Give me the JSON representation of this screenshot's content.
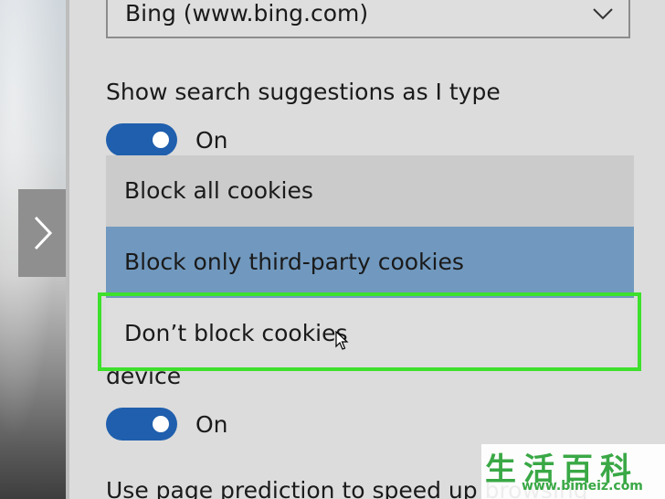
{
  "search_engine": {
    "selected": "Bing (www.bing.com)"
  },
  "search_suggestions": {
    "label": "Show search suggestions as I type",
    "toggle_state": "On"
  },
  "cookies_dropdown": {
    "options": [
      "Block all cookies",
      "Block only third-party cookies",
      "Don’t block cookies"
    ],
    "selected_index": 1,
    "hovered_index": 2
  },
  "device_setting": {
    "label_tail": "device",
    "toggle_state": "On"
  },
  "page_prediction": {
    "label": "Use page prediction to speed up browsing"
  },
  "watermark": {
    "chinese": "生活百科",
    "url": "www.bimeiz.com"
  },
  "colors": {
    "toggle_on": "#1f5fad",
    "selected_option": "#7199bf",
    "highlight_box": "#3de02c",
    "watermark": "#39a845"
  },
  "icons": {
    "select_arrow": "chevron-down-icon",
    "nav_arrow": "chevron-right-icon",
    "pointer": "mouse-cursor-icon"
  }
}
